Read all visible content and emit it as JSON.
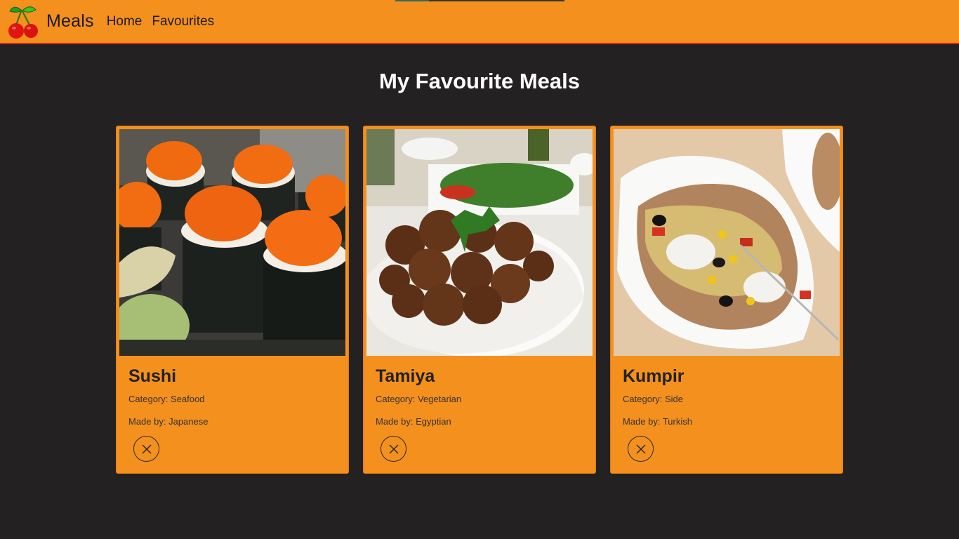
{
  "navbar": {
    "brand": "Meals",
    "links": [
      "Home",
      "Favourites"
    ],
    "background": "#f4901d",
    "border_color": "#d8261c"
  },
  "page": {
    "title": "My Favourite Meals",
    "background": "#242122"
  },
  "meals": [
    {
      "name": "Sushi",
      "category_label": "Category: Seafood",
      "origin_label": "Made by: Japanese",
      "image": "sushi-photo",
      "remove_icon": "close-circle-icon"
    },
    {
      "name": "Tamiya",
      "category_label": "Category: Vegetarian",
      "origin_label": "Made by: Egyptian",
      "image": "falafel-photo",
      "remove_icon": "close-circle-icon"
    },
    {
      "name": "Kumpir",
      "category_label": "Category: Side",
      "origin_label": "Made by: Turkish",
      "image": "baked-potato-photo",
      "remove_icon": "close-circle-icon"
    }
  ]
}
